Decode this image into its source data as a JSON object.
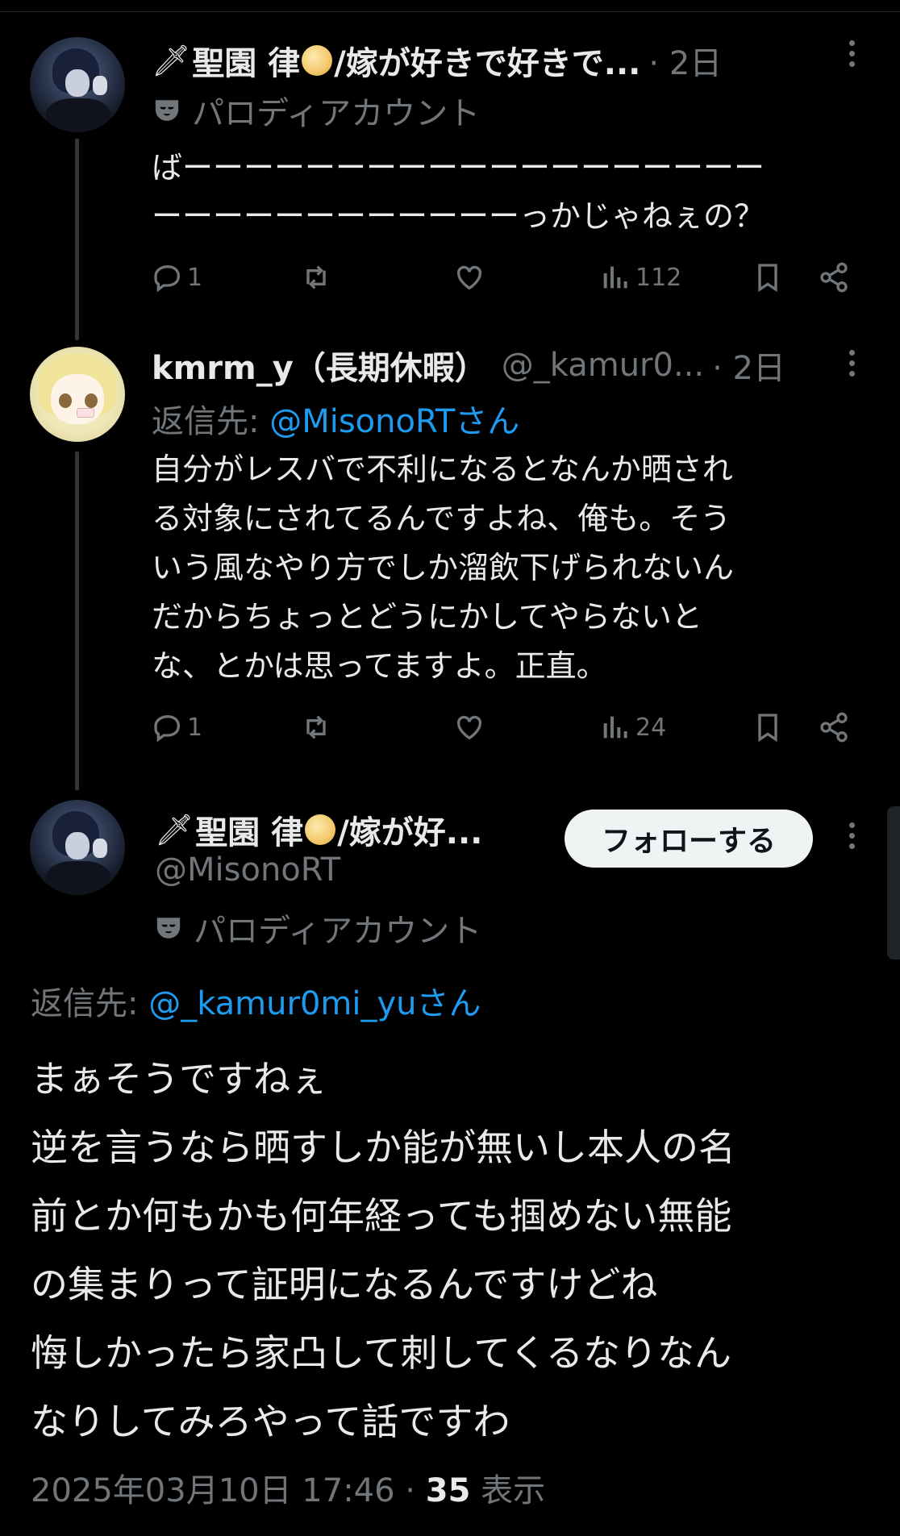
{
  "post1": {
    "display_name": "聖園 律",
    "name_suffix": "/嫁が好きで好きで...",
    "time": "· 2日",
    "parody_label": "パロディアカウント",
    "text_lines": [
      "ばーーーーーーーーーーーーーーーーーーー",
      "ーーーーーーーーーーーーっかじゃねぇの？"
    ],
    "replies": "1",
    "retweets": "",
    "likes": "",
    "views": "112"
  },
  "post2": {
    "display_name": "kmrm_y（長期休暇）",
    "handle": "@_kamur0...",
    "time": "· 2日",
    "reply_prefix": "返信先: ",
    "reply_mention": "@MisonoRTさん",
    "text_lines": [
      "自分がレスバで不利になるとなんか晒され",
      "る対象にされてるんですよね、俺も。そう",
      "いう風なやり方でしか溜飲下げられないん",
      "だからちょっとどうにかしてやらないと",
      "な、とかは思ってますよ。正直。"
    ],
    "replies": "1",
    "views": "24"
  },
  "main_post": {
    "display_name": "聖園 律",
    "name_suffix": "/嫁が好...",
    "handle": "@MisonoRT",
    "parody_label": "パロディアカウント",
    "follow_label": "フォローする",
    "reply_prefix": "返信先: ",
    "reply_mention": "@_kamur0mi_yuさん",
    "text_lines": [
      "まぁそうですねぇ",
      "逆を言うなら晒すしか能が無いし本人の名",
      "前とか何もかも何年経っても掴めない無能",
      "の集まりって証明になるんですけどね",
      "悔しかったら家凸して刺してくるなりなん",
      "なりしてみろやって話ですわ"
    ],
    "timestamp": "2025年03月10日 17:46 · ",
    "view_count": "35",
    "view_label": " 表示"
  },
  "icons": [
    "dagger-emoji",
    "full-moon-emoji",
    "mask-icon",
    "reply-icon",
    "retweet-icon",
    "like-icon",
    "views-icon",
    "bookmark-icon",
    "share-icon",
    "more-icon"
  ],
  "colors": {
    "background": "#000000",
    "text": "#e7e9ea",
    "muted": "#71767b",
    "link": "#1d9bf0",
    "button_bg": "#eff3f4"
  }
}
